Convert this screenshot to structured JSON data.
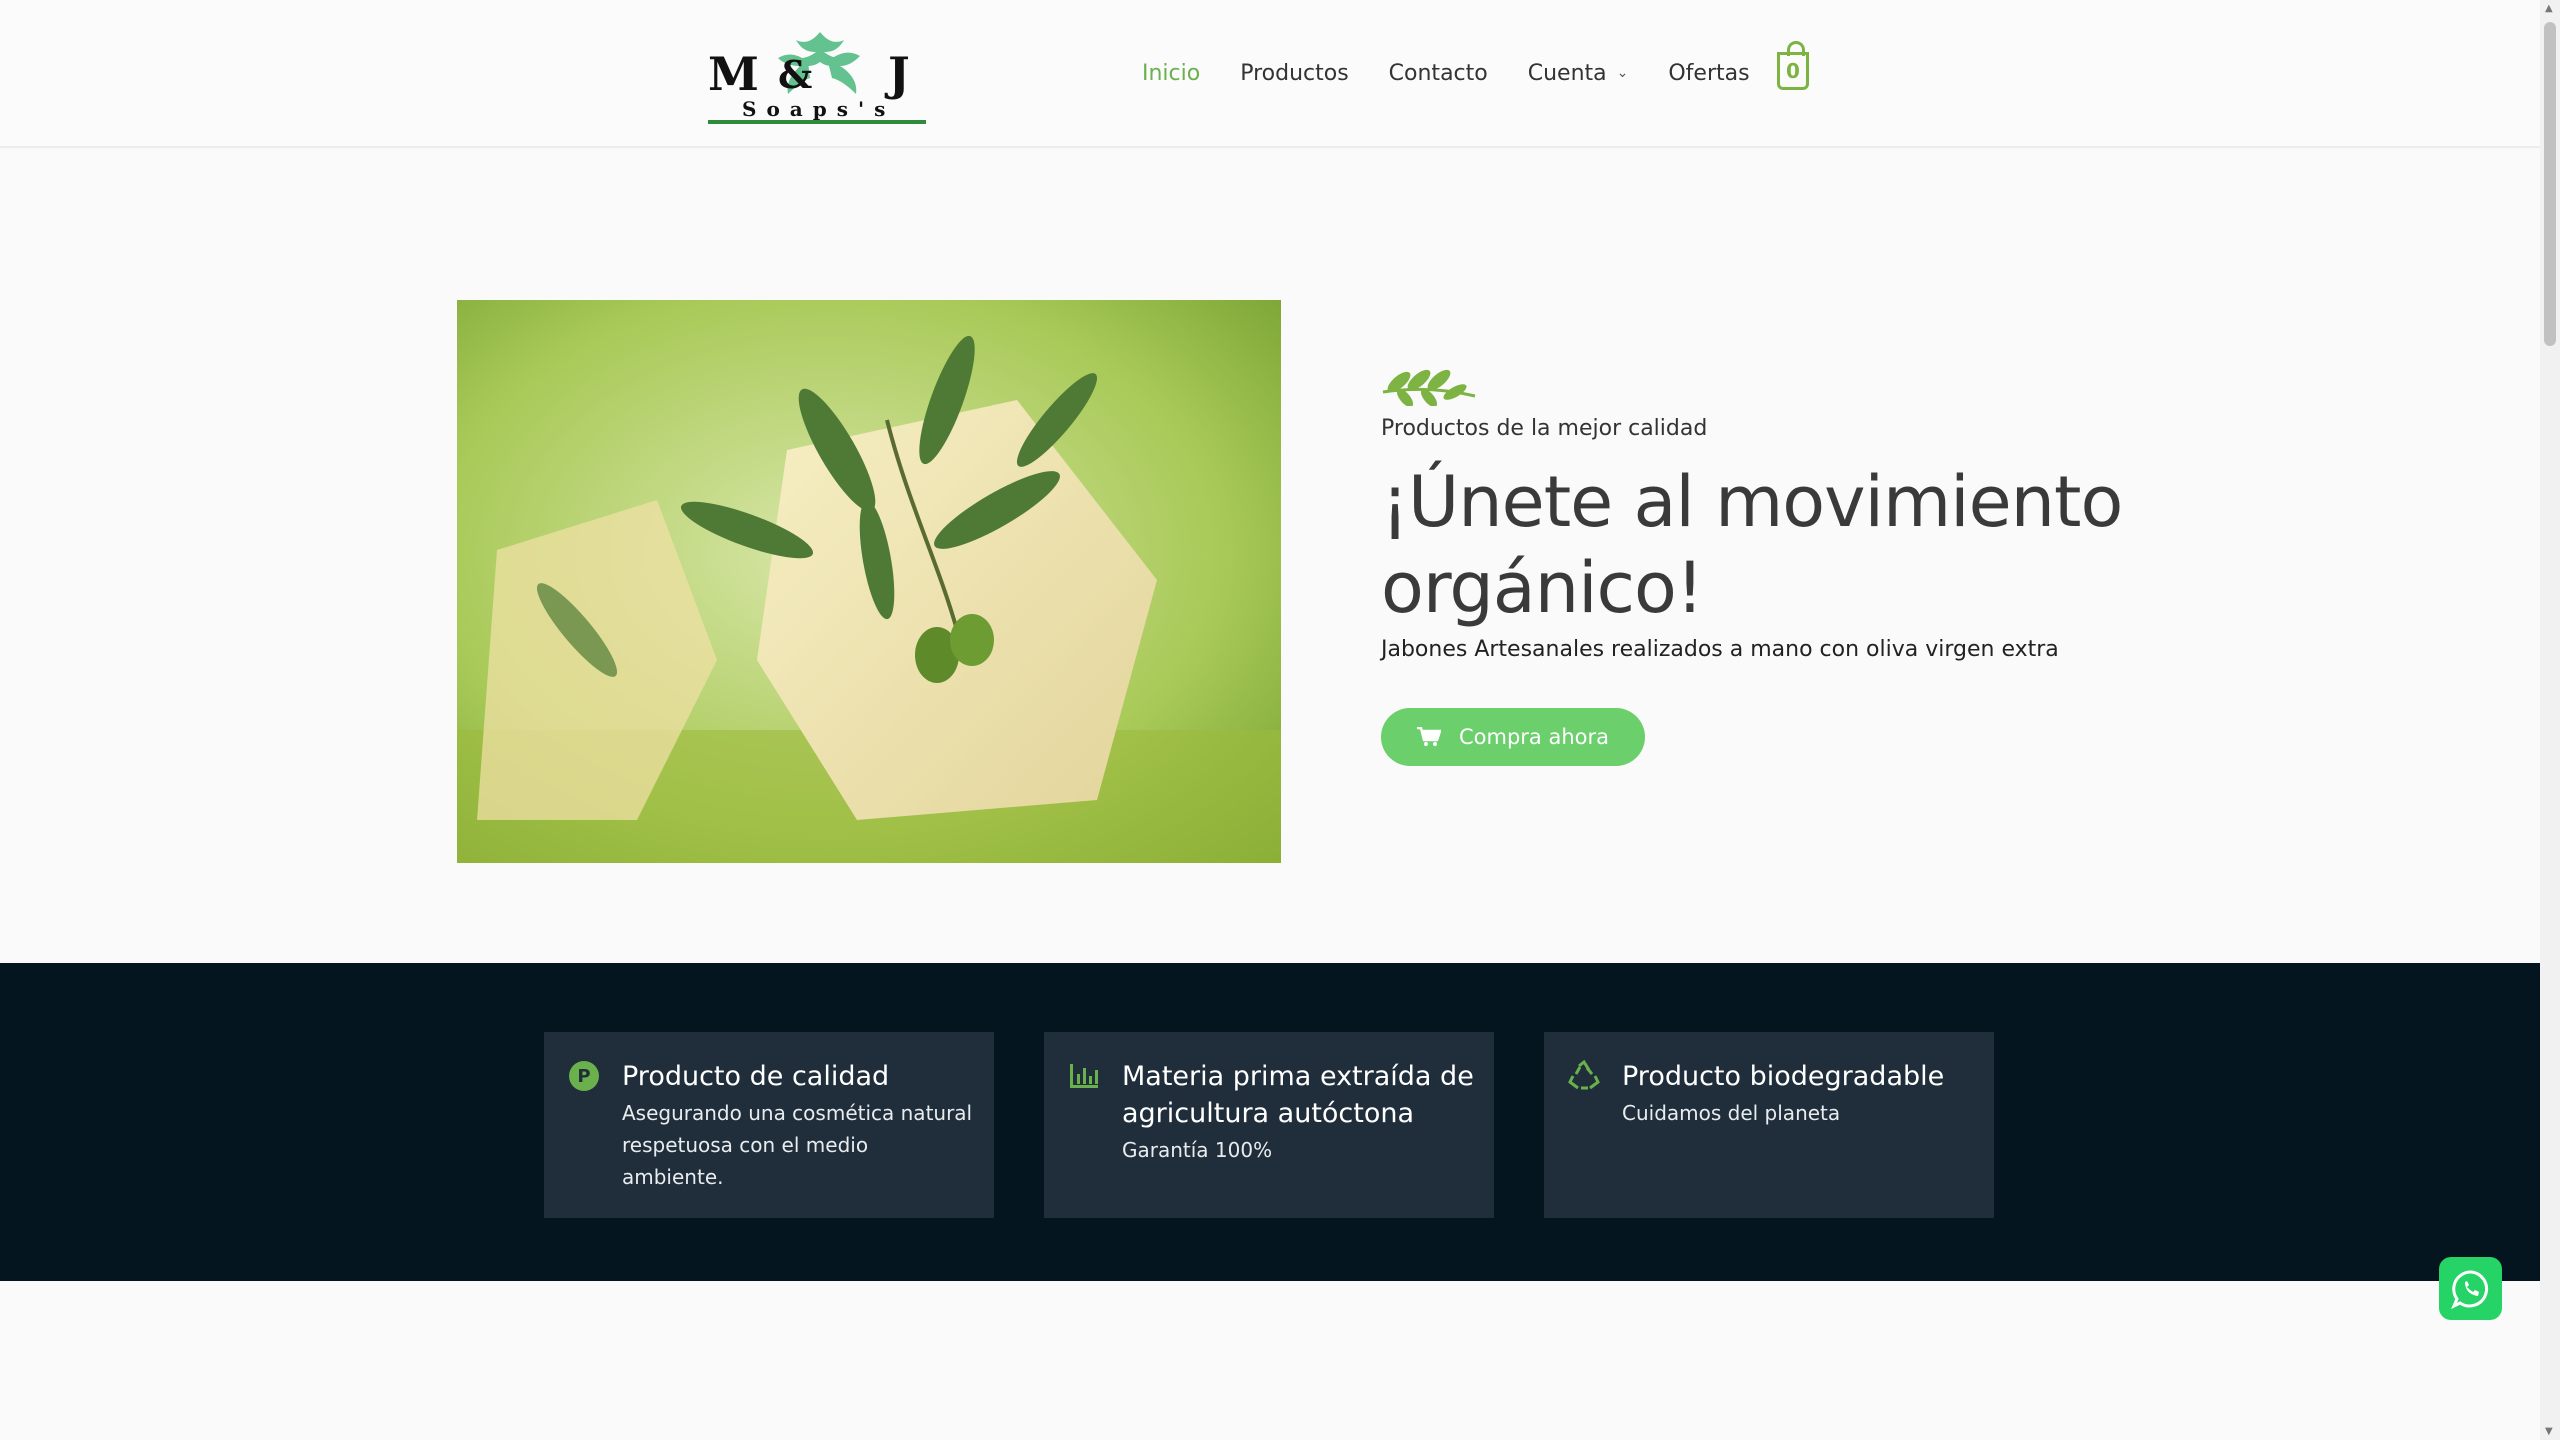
{
  "header": {
    "logo_text_top": "M&J",
    "logo_text_bottom": "Soaps's",
    "nav": [
      {
        "label": "Inicio",
        "active": true
      },
      {
        "label": "Productos"
      },
      {
        "label": "Contacto"
      },
      {
        "label": "Cuenta",
        "has_dropdown": true
      },
      {
        "label": "Ofertas"
      }
    ],
    "cart_count": "0"
  },
  "hero": {
    "subtitle": "Productos de la mejor calidad",
    "headline_line1": "¡Únete al movimiento",
    "headline_line2": "orgánico!",
    "description": "Jabones Artesanales realizados a mano con oliva virgen extra",
    "button_label": "Compra ahora",
    "image_alt": "olive-soap-image"
  },
  "features": [
    {
      "icon": "p-badge-icon",
      "title": "Producto de calidad",
      "desc": "Asegurando una cosmética natural respetuosa con el medio ambiente."
    },
    {
      "icon": "bar-chart-icon",
      "title": "Materia prima extraída de agricultura autóctona",
      "desc": "Garantía 100%"
    },
    {
      "icon": "recycle-icon",
      "title": "Producto biodegradable",
      "desc": "Cuidamos del planeta"
    }
  ],
  "colors": {
    "accent_green": "#6ab04c",
    "button_green": "#6bcf6b",
    "dark_band": "#05151f",
    "card_bg": "#1f2e3a",
    "whatsapp": "#25d366"
  }
}
